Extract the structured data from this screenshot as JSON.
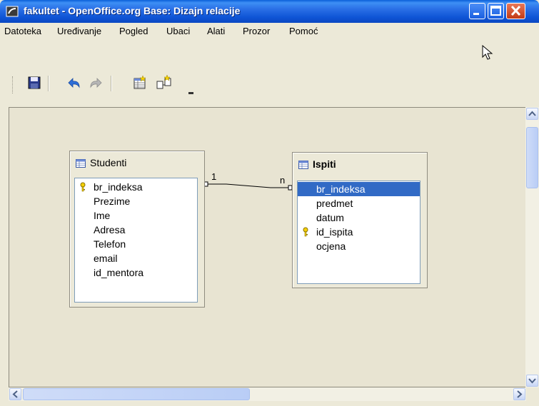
{
  "window": {
    "title": "fakultet - OpenOffice.org Base: Dizajn relacije"
  },
  "menu": {
    "items": [
      {
        "label": "Datoteka"
      },
      {
        "label": "Uređivanje"
      },
      {
        "label": "Pogled"
      },
      {
        "label": "Ubaci"
      },
      {
        "label": "Alati"
      },
      {
        "label": "Prozor"
      },
      {
        "label": "Pomoć"
      }
    ]
  },
  "tables": [
    {
      "name": "Studenti",
      "fields": [
        {
          "label": "br_indeksa",
          "key": true
        },
        {
          "label": "Prezime"
        },
        {
          "label": "Ime"
        },
        {
          "label": "Adresa"
        },
        {
          "label": "Telefon"
        },
        {
          "label": "email"
        },
        {
          "label": "id_mentora"
        }
      ]
    },
    {
      "name": "Ispiti",
      "fields": [
        {
          "label": "br_indeksa",
          "selected": true
        },
        {
          "label": "predmet"
        },
        {
          "label": "datum"
        },
        {
          "label": "id_ispita",
          "key": true
        },
        {
          "label": "ocjena"
        }
      ]
    }
  ],
  "relation": {
    "left_cardinality": "1",
    "right_cardinality": "n"
  },
  "icons": [
    "app-icon",
    "minimize-icon",
    "maximize-icon",
    "close-icon",
    "save-icon",
    "undo-icon",
    "redo-icon",
    "new-table-icon",
    "new-relation-icon",
    "key-icon",
    "table-icon",
    "mouse-pointer"
  ],
  "colors": {
    "titlebar": "#0a5fd8",
    "selection": "#316ac5",
    "canvas": "#e8e4d2"
  }
}
